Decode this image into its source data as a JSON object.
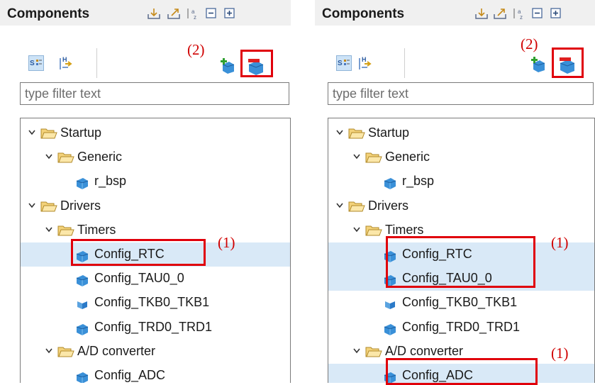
{
  "panels": [
    {
      "title": "Components",
      "filter_placeholder": "type filter text",
      "annotation_toolbar": "(2)",
      "annotations": [
        "(1)"
      ],
      "tree": [
        {
          "label": "Startup",
          "kind": "folder",
          "selected": false
        },
        {
          "label": "Generic",
          "kind": "folder",
          "selected": false
        },
        {
          "label": "r_bsp",
          "kind": "component",
          "selected": false
        },
        {
          "label": "Drivers",
          "kind": "folder",
          "selected": false
        },
        {
          "label": "Timers",
          "kind": "folder",
          "selected": false
        },
        {
          "label": "Config_RTC",
          "kind": "component",
          "selected": true
        },
        {
          "label": "Config_TAU0_0",
          "kind": "component",
          "selected": false
        },
        {
          "label": "Config_TKB0_TKB1",
          "kind": "component-alt",
          "selected": false
        },
        {
          "label": "Config_TRD0_TRD1",
          "kind": "component",
          "selected": false
        },
        {
          "label": "A/D converter",
          "kind": "folder",
          "selected": false
        },
        {
          "label": "Config_ADC",
          "kind": "component",
          "selected": false
        }
      ]
    },
    {
      "title": "Components",
      "filter_placeholder": "type filter text",
      "annotation_toolbar": "(2)",
      "annotations": [
        "(1)",
        "(1)"
      ],
      "tree": [
        {
          "label": "Startup",
          "kind": "folder",
          "selected": false
        },
        {
          "label": "Generic",
          "kind": "folder",
          "selected": false
        },
        {
          "label": "r_bsp",
          "kind": "component",
          "selected": false
        },
        {
          "label": "Drivers",
          "kind": "folder",
          "selected": false
        },
        {
          "label": "Timers",
          "kind": "folder",
          "selected": false
        },
        {
          "label": "Config_RTC",
          "kind": "component",
          "selected": true
        },
        {
          "label": "Config_TAU0_0",
          "kind": "component",
          "selected": true
        },
        {
          "label": "Config_TKB0_TKB1",
          "kind": "component-alt",
          "selected": false
        },
        {
          "label": "Config_TRD0_TRD1",
          "kind": "component",
          "selected": false
        },
        {
          "label": "A/D converter",
          "kind": "folder",
          "selected": false
        },
        {
          "label": "Config_ADC",
          "kind": "component",
          "selected": true
        }
      ]
    }
  ],
  "colors": {
    "highlight": "#e0000b",
    "selection": "#d9e9f7",
    "annotation": "#d00000"
  },
  "icons": {
    "header": [
      "import-icon",
      "export-icon",
      "sort-az-icon",
      "collapse-all-icon",
      "expand-all-icon"
    ],
    "view_toggles": [
      "component-view-icon",
      "hardware-view-icon"
    ],
    "actions": [
      "add-component-icon",
      "remove-component-icon"
    ]
  }
}
